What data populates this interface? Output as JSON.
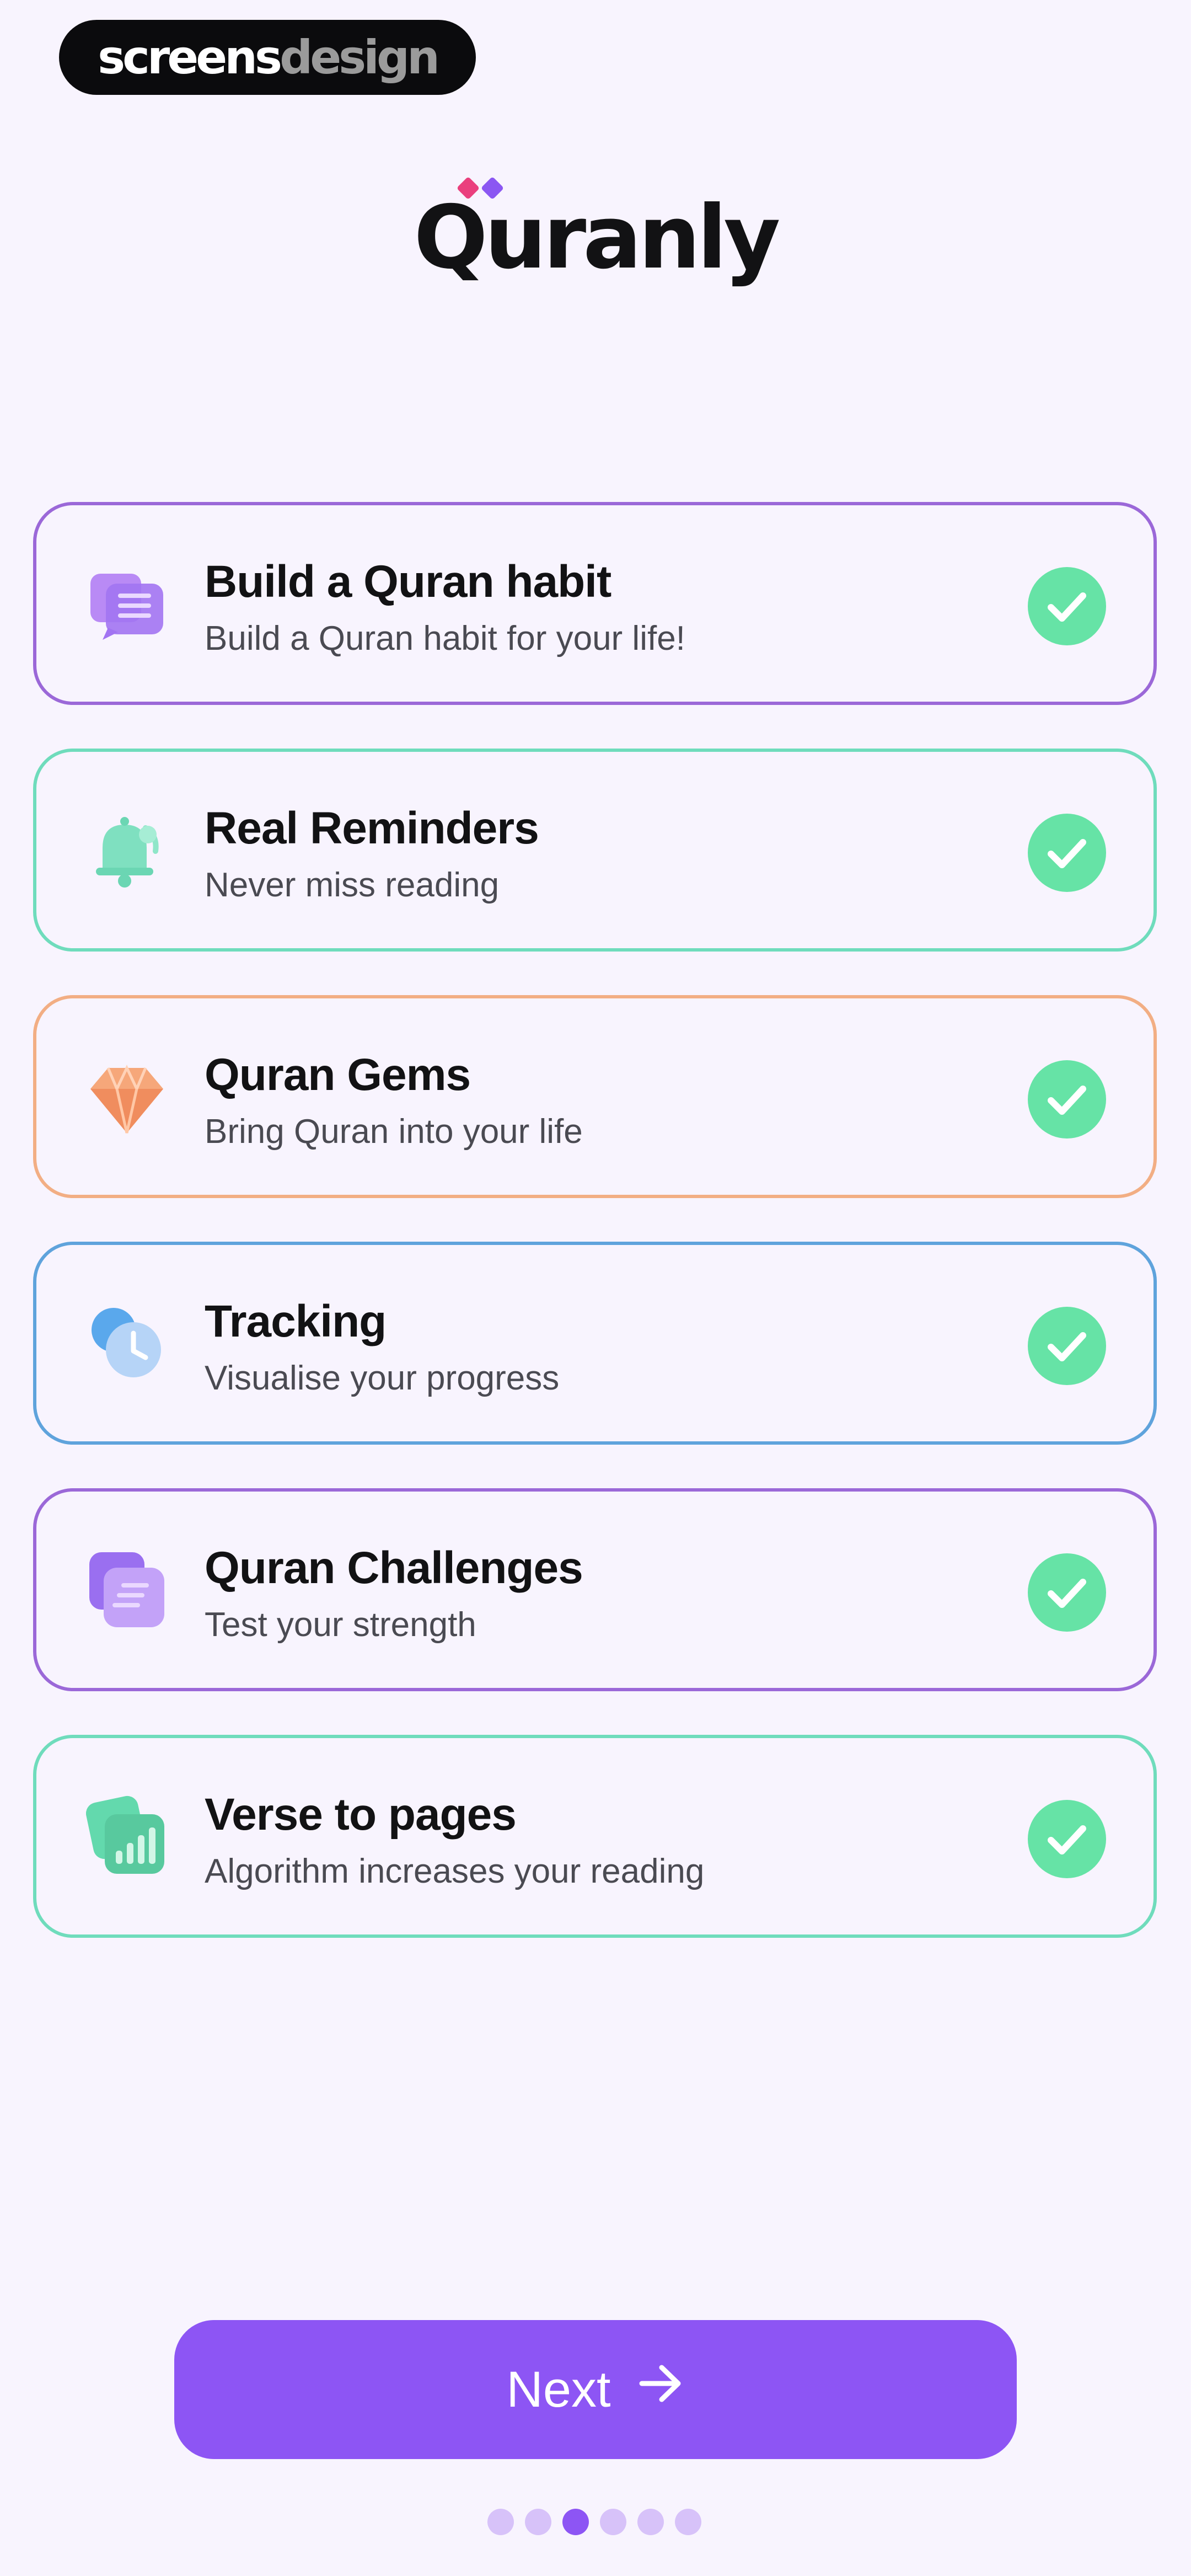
{
  "watermark": {
    "part1": "screens",
    "part2": "design"
  },
  "app": {
    "title": "Quranly"
  },
  "features": [
    {
      "title": "Build a Quran habit",
      "subtitle": "Build a Quran habit for your life!",
      "icon": "book-chat-icon",
      "border_color": "#9b68d8",
      "checked": true
    },
    {
      "title": "Real Reminders",
      "subtitle": "Never miss reading",
      "icon": "bell-icon",
      "border_color": "#6fdcbc",
      "checked": true
    },
    {
      "title": "Quran Gems",
      "subtitle": "Bring Quran into your life",
      "icon": "gem-icon",
      "border_color": "#f2ae84",
      "checked": true
    },
    {
      "title": "Tracking",
      "subtitle": "Visualise your progress",
      "icon": "clock-icon",
      "border_color": "#5fa3dc",
      "checked": true
    },
    {
      "title": "Quran Challenges",
      "subtitle": "Test your strength",
      "icon": "cards-icon",
      "border_color": "#9b68d8",
      "checked": true
    },
    {
      "title": "Verse to pages",
      "subtitle": "Algorithm increases your reading",
      "icon": "bar-chart-icon",
      "border_color": "#6fdcbc",
      "checked": true
    }
  ],
  "next_button": {
    "label": "Next",
    "icon": "arrow-right-icon"
  },
  "pagination": {
    "total": 6,
    "current": 3
  },
  "colors": {
    "accent": "#8d55f4",
    "check": "#66e3a6",
    "background": "#f8f4fe"
  }
}
